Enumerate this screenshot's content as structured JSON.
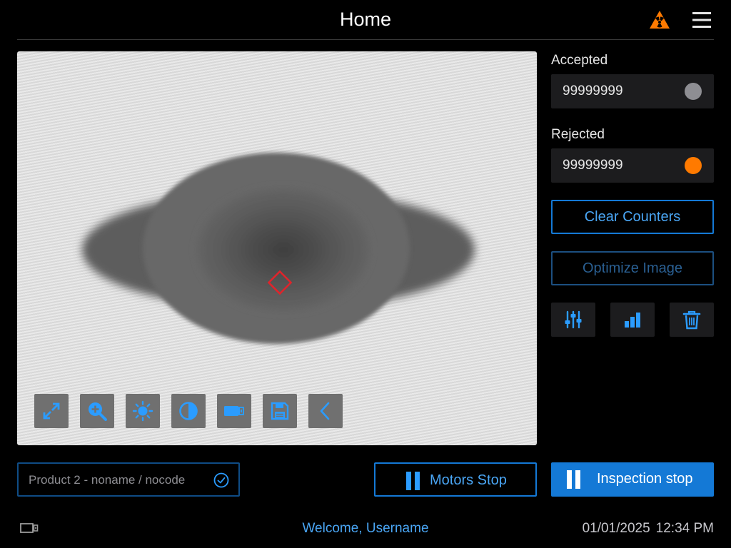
{
  "header": {
    "title": "Home",
    "radiation_icon": "radiation-warning-icon",
    "menu_icon": "hamburger-menu-icon"
  },
  "viewer": {
    "tools": [
      {
        "name": "expand-icon"
      },
      {
        "name": "zoom-in-icon"
      },
      {
        "name": "brightness-icon"
      },
      {
        "name": "contrast-icon"
      },
      {
        "name": "camera-icon"
      },
      {
        "name": "save-icon"
      },
      {
        "name": "chevron-left-icon"
      }
    ]
  },
  "counters": {
    "accepted": {
      "label": "Accepted",
      "value": "99999999",
      "dot_color": "#8e8e93"
    },
    "rejected": {
      "label": "Rejected",
      "value": "99999999",
      "dot_color": "#ff7a00"
    }
  },
  "actions": {
    "clear_counters": "Clear Counters",
    "optimize_image": "Optimize Image",
    "icons": [
      "sliders-icon",
      "bar-chart-icon",
      "trash-icon"
    ]
  },
  "product": {
    "label": "Product 2 - noname / nocode",
    "status_icon": "check-circle-icon"
  },
  "controls": {
    "motors_stop": "Motors Stop",
    "inspection_stop": "Inspection stop"
  },
  "footer": {
    "welcome": "Welcome, Username",
    "date": "01/01/2025",
    "time": "12:34 PM"
  },
  "colors": {
    "accent": "#1479d6",
    "accent_text": "#4aa6f5",
    "rejected_indicator": "#ff7a00",
    "marker": "#e0242b"
  }
}
